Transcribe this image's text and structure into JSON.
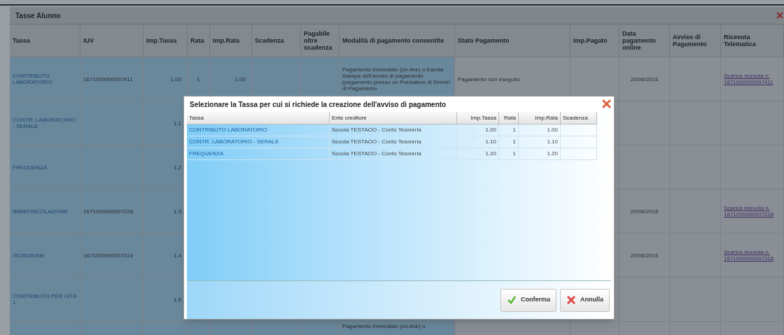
{
  "window": {
    "title": "Tasse Alunno"
  },
  "table": {
    "columns": [
      "Tassa",
      "IUV",
      "Imp.Tassa",
      "Rata",
      "Imp.Rata",
      "Scadenza",
      "Pagabile oltre scadenza",
      "Modalità di pagamento consentite",
      "Stato Pagamento",
      "Imp.Pagato",
      "Data pagamento online",
      "Avviso di Pagamento",
      "Ricevuta Telematica"
    ],
    "rows": [
      {
        "tassa": "CONTRIBUTO LABORATORIO",
        "iuv": "1671000000007411",
        "imp_tassa": "1.00",
        "rata": "1",
        "imp_rata": "1.00",
        "modalita": "Pagamento immediato (on-line) o tramite stampa dell'avviso di pagamento (pagamento presso un Prestatore di Servizi di Pagamento",
        "stato": "Pagamento non eseguito",
        "data": "20/06/2016",
        "ricevuta": "Scarica ricevuta n. 1671000000007411"
      },
      {
        "tassa": "CONTR. LABORATORIO - SERALE",
        "imp_tassa": "1.1"
      },
      {
        "tassa": "FREQUENZA",
        "imp_tassa": "1.2"
      },
      {
        "tassa": "IMMATRICOLAZIONE",
        "iuv": "1671000000007228",
        "imp_tassa": "1.3",
        "data": "20/06/2016",
        "ricevuta": "Scarica ricevuta n. 1671000000007228"
      },
      {
        "tassa": "ISCRIZIONE",
        "iuv": "1671000000007316",
        "imp_tassa": "1.4",
        "data": "20/06/2016",
        "ricevuta": "Scarica ricevuta n. 1671000000007316"
      },
      {
        "tassa": "CONTRIBUTO PER GITA 1",
        "imp_tassa": "1.5"
      },
      {
        "modalita": "Pagamento immediato (on-line) o"
      }
    ]
  },
  "dialog": {
    "title": "Selezionare la Tassa per cui si richiede la creazione dell'avviso di pagamento",
    "columns": [
      "Tassa",
      "Ente creditore",
      "Imp.Tassa",
      "Rata",
      "Imp.Rata",
      "Scadenza"
    ],
    "rows": [
      {
        "tassa": "CONTRIBUTO LABORATORIO",
        "ente": "Scuola TESTAOO - Conto Tesoreria",
        "imp_tassa": "1.00",
        "rata": "1",
        "imp_rata": "1.00"
      },
      {
        "tassa": "CONTR. LABORATORIO - SERALE",
        "ente": "Scuola TESTAOO - Conto Tesoreria",
        "imp_tassa": "1.10",
        "rata": "1",
        "imp_rata": "1.10"
      },
      {
        "tassa": "FREQUENZA",
        "ente": "Scuola TESTAOO - Conto Tesoreria",
        "imp_tassa": "1.20",
        "rata": "1",
        "imp_rata": "1.20"
      }
    ],
    "buttons": [
      {
        "label": "Conferma",
        "kind": "confirm"
      },
      {
        "label": "Annulla",
        "kind": "cancel"
      }
    ]
  }
}
